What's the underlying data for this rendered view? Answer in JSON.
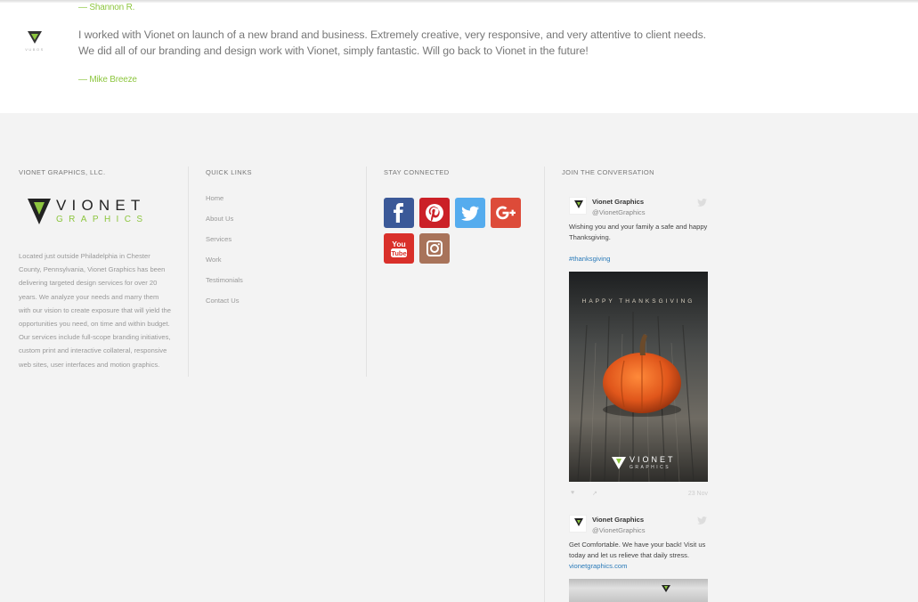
{
  "testimonials": {
    "author_1": "— Shannon R.",
    "quote_2": "I worked with Vionet on launch of a new brand and business. Extremely creative, very responsive, and very attentive to client needs. We did all of our branding and design work with Vionet, simply fantastic. Will go back to Vionet in the future!",
    "author_2": "— Mike Breeze",
    "client_logo_caption": "VUBOS"
  },
  "footer": {
    "company": {
      "heading": "VIONET GRAPHICS, LLC.",
      "logo_word": "VIONET",
      "logo_sub": "GRAPHICS",
      "about": "Located just outside Philadelphia in Chester County, Pennsylvania, Vionet Graphics has been delivering targeted design services for over 20 years. We analyze your needs and marry them with our vision to create exposure that will yield the opportunities you need, on time and within budget. Our services include full-scope branding initiatives, custom print and interactive collateral, responsive web sites, user interfaces and motion graphics."
    },
    "quick_links": {
      "heading": "QUICK LINKS",
      "items": [
        "Home",
        "About Us",
        "Services",
        "Work",
        "Testimonials",
        "Contact Us"
      ]
    },
    "stay_connected": {
      "heading": "STAY CONNECTED",
      "icons": [
        "facebook-icon",
        "pinterest-icon",
        "twitter-icon",
        "google-plus-icon",
        "youtube-icon",
        "instagram-icon"
      ],
      "colors": {
        "facebook": "#3b5998",
        "pinterest": "#cb2027",
        "twitter": "#55acee",
        "google_plus": "#dd4b39",
        "youtube": "#d9302a",
        "instagram": "#a8735a"
      },
      "youtube_label_top": "You",
      "youtube_label_bottom": "Tube"
    },
    "conversation": {
      "heading": "JOIN THE CONVERSATION",
      "tweets": [
        {
          "name": "Vionet Graphics",
          "handle": "@VionetGraphics",
          "text": "Wishing you and your family a safe and happy Thanksgiving.",
          "hashtag": "#thanksgiving",
          "image_caption": "HAPPY THANKSGIVING",
          "image_logo_word": "VIONET",
          "image_logo_sub": "GRAPHICS",
          "time": "23 Nov"
        },
        {
          "name": "Vionet Graphics",
          "handle": "@VionetGraphics",
          "text": "Get Comfortable. We have your back!  Visit us today and let us relieve that daily stress.",
          "link": "vionetgraphics.com"
        }
      ]
    }
  }
}
